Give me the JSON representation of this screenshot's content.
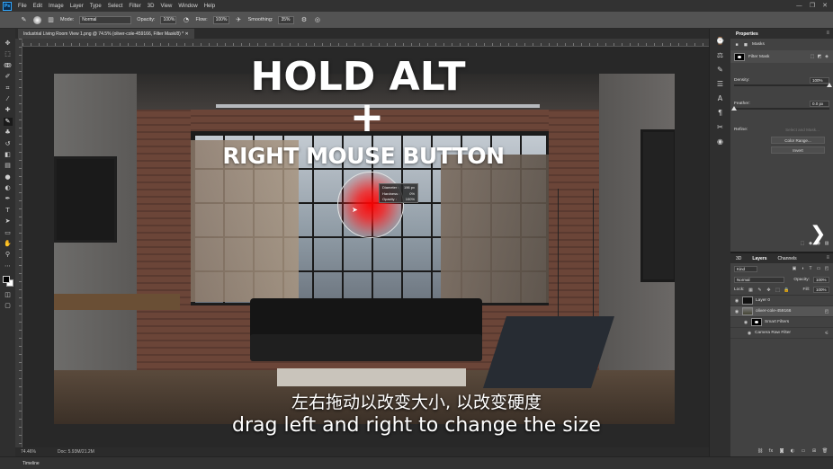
{
  "app": {
    "logo": "Ps"
  },
  "menu": [
    "File",
    "Edit",
    "Image",
    "Layer",
    "Type",
    "Select",
    "Filter",
    "3D",
    "View",
    "Window",
    "Help"
  ],
  "window_controls": [
    "—",
    "❐",
    "✕"
  ],
  "options_bar": {
    "mode_label": "Mode:",
    "mode_value": "Normal",
    "opacity_label": "Opacity:",
    "opacity_value": "100%",
    "flow_label": "Flow:",
    "flow_value": "100%",
    "smoothing_label": "Smoothing:",
    "smoothing_value": "35%"
  },
  "document_tab": "Industrial Living Room View 1.png @ 74.5% (oliver-cole-459166, Filter Mask/8) * ✕",
  "overlay": {
    "title": "HOLD ALT",
    "plus": "+",
    "subtitle": "RIGHT MOUSE BUTTON"
  },
  "brush_hud": [
    {
      "label": "Diameter :",
      "value": "196 px"
    },
    {
      "label": "Hardness :",
      "value": "0%"
    },
    {
      "label": "Opacity :",
      "value": "100%"
    }
  ],
  "subtitles": {
    "chinese": "左右拖动以改变大小, 以改变硬度",
    "english": "drag left and right to change the size"
  },
  "status": {
    "zoom": "74.46%",
    "doc": "Doc: 5.93M/21.2M"
  },
  "timeline_label": "Timeline",
  "properties": {
    "title": "Properties",
    "section": "Masks",
    "mask_type": "Filter Mask",
    "density_label": "Density:",
    "density_value": "100%",
    "density_level": 1.0,
    "feather_label": "Feather:",
    "feather_value": "0.0 px",
    "feather_level": 0.0,
    "refine_label": "Refine:",
    "select_mask_btn": "Select and Mask...",
    "color_range_btn": "Color Range...",
    "invert_btn": "Invert"
  },
  "layers": {
    "tabs": [
      "3D",
      "Layers",
      "Channels"
    ],
    "kind_label": "Kind",
    "blend_mode": "Normal",
    "opacity_label": "Opacity:",
    "opacity_value": "100%",
    "lock_label": "Lock:",
    "fill_label": "Fill:",
    "fill_value": "100%",
    "rows": [
      {
        "name": "Layer 0"
      },
      {
        "name": "oliver-cole-459166"
      },
      {
        "name": "Smart Filters"
      },
      {
        "name": "Camera Raw Filter"
      }
    ]
  },
  "colors": {
    "accent": "#31a8ff",
    "brush_red": "#ff1a1a",
    "panel_bg": "#424242"
  }
}
